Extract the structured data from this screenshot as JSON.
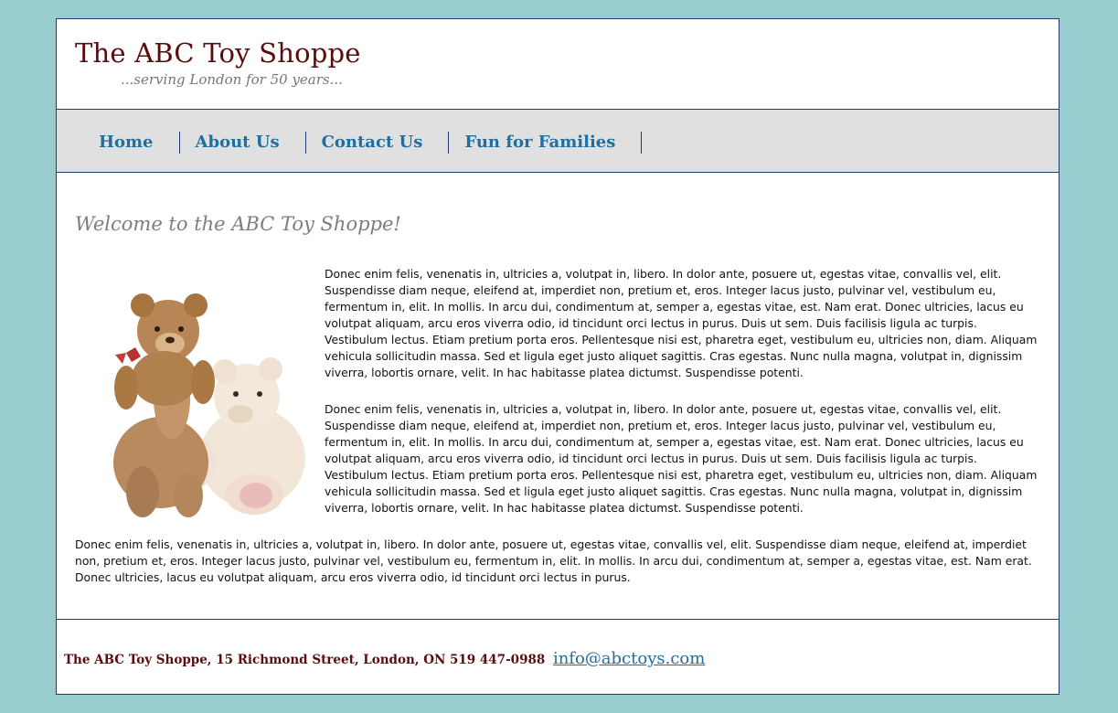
{
  "header": {
    "title": "The ABC Toy Shoppe",
    "tagline": "...serving London for 50 years..."
  },
  "nav": {
    "items": [
      {
        "label": "Home"
      },
      {
        "label": "About Us"
      },
      {
        "label": "Contact Us"
      },
      {
        "label": "Fun for Families"
      }
    ]
  },
  "main": {
    "heading": "Welcome to the ABC Toy Shoppe!",
    "image_icon": "teddy-bears-image",
    "paragraphs": [
      "Donec enim felis, venenatis in, ultricies a, volutpat in, libero. In dolor ante, posuere ut, egestas vitae, convallis vel, elit. Suspendisse diam neque, eleifend at, imperdiet non, pretium et, eros. Integer lacus justo, pulvinar vel, vestibulum eu, fermentum in, elit. In mollis. In arcu dui, condimentum at, semper a, egestas vitae, est. Nam erat. Donec ultricies, lacus eu volutpat aliquam, arcu eros viverra odio, id tincidunt orci lectus in purus. Duis ut sem. Duis facilisis ligula ac turpis. Vestibulum lectus. Etiam pretium porta eros. Pellentesque nisi est, pharetra eget, vestibulum eu, ultricies non, diam. Aliquam vehicula sollicitudin massa. Sed et ligula eget justo aliquet sagittis. Cras egestas. Nunc nulla magna, volutpat in, dignissim viverra, lobortis ornare, velit. In hac habitasse platea dictumst. Suspendisse potenti.",
      "Donec enim felis, venenatis in, ultricies a, volutpat in, libero. In dolor ante, posuere ut, egestas vitae, convallis vel, elit. Suspendisse diam neque, eleifend at, imperdiet non, pretium et, eros. Integer lacus justo, pulvinar vel, vestibulum eu, fermentum in, elit. In mollis. In arcu dui, condimentum at, semper a, egestas vitae, est. Nam erat. Donec ultricies, lacus eu volutpat aliquam, arcu eros viverra odio, id tincidunt orci lectus in purus. Duis ut sem. Duis facilisis ligula ac turpis. Vestibulum lectus. Etiam pretium porta eros. Pellentesque nisi est, pharetra eget, vestibulum eu, ultricies non, diam. Aliquam vehicula sollicitudin massa. Sed et ligula eget justo aliquet sagittis. Cras egestas. Nunc nulla magna, volutpat in, dignissim viverra, lobortis ornare, velit. In hac habitasse platea dictumst. Suspendisse potenti.",
      "Donec enim felis, venenatis in, ultricies a, volutpat in, libero. In dolor ante, posuere ut, egestas vitae, convallis vel, elit. Suspendisse diam neque, eleifend at, imperdiet non, pretium et, eros. Integer lacus justo, pulvinar vel, vestibulum eu, fermentum in, elit. In mollis. In arcu dui, condimentum at, semper a, egestas vitae, est. Nam erat. Donec ultricies, lacus eu volutpat aliquam, arcu eros viverra odio, id tincidunt orci lectus in purus."
    ]
  },
  "footer": {
    "address": "The ABC Toy Shoppe, 15 Richmond Street, London, ON 519 447-0988",
    "email": "info@abctoys.com"
  },
  "colors": {
    "background": "#99ccce",
    "title": "#5a0d0d",
    "nav_link": "#1f6fa0",
    "nav_bg": "#e0e0e0",
    "border": "#1f3f6b"
  }
}
